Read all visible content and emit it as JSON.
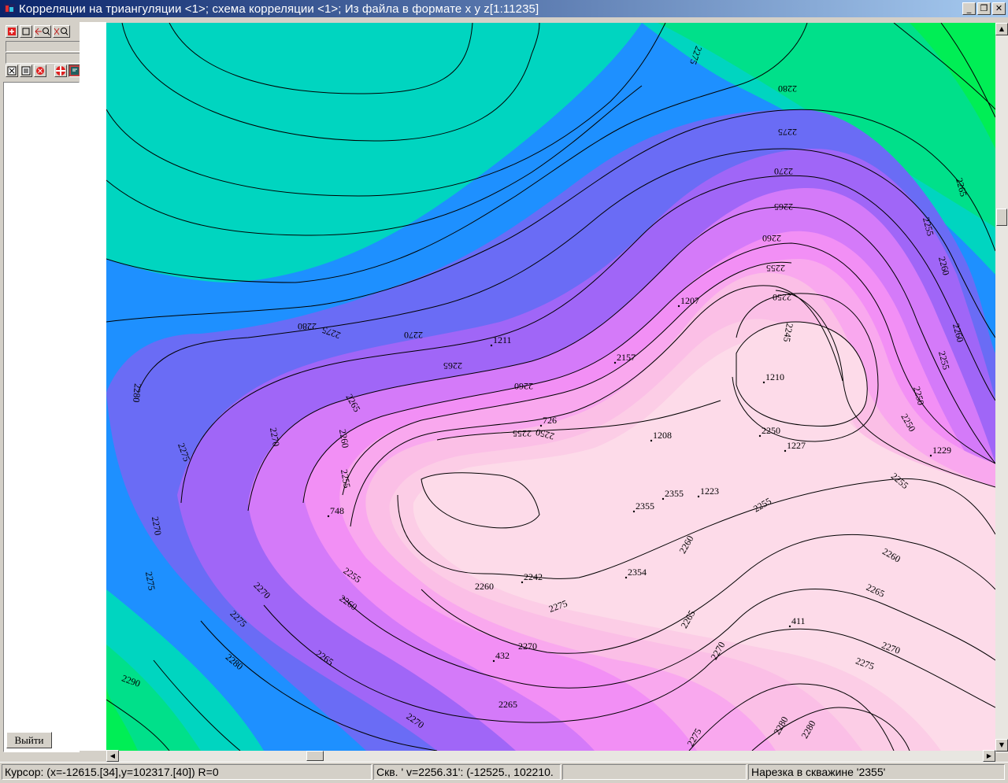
{
  "window": {
    "title": "Корреляции на триангуляции <1>; схема корреляции <1>; Из файла в формате x y z[1:11235]",
    "controls": [
      "_",
      "❐",
      "✕"
    ]
  },
  "left_panel": {
    "exit_label": "Выйти"
  },
  "status_bar": {
    "cursor": "Курсор: (x=-12615.[34],y=102317.[40]) R=0",
    "well": "Скв. ' v=2256.31': (-12525., 102210.",
    "empty": "",
    "cut": "Нарезка в скважине '2355'"
  },
  "map": {
    "palette": [
      "#00ee55",
      "#00e08a",
      "#00d5c0",
      "#00c0e8",
      "#1e90ff",
      "#6a6cf5",
      "#a066f7",
      "#d47af9",
      "#f28ff5",
      "#f9a8ee",
      "#fbbfe6",
      "#fccde6",
      "#fddbe9"
    ],
    "contour_labels": [
      "2275",
      "2280",
      "2275",
      "2270",
      "2265",
      "2260",
      "2255",
      "2250",
      "2245",
      "2280",
      "2275",
      "2270",
      "2265",
      "2260",
      "2255",
      "2250",
      "2255",
      "2260",
      "2265",
      "2270",
      "2275",
      "2280",
      "2255",
      "2260",
      "2265",
      "2270",
      "2275",
      "2280",
      "2290",
      "2270",
      "2265",
      "2270",
      "2275",
      "2250",
      "2255",
      "2260",
      "2265",
      "2270",
      "2275",
      "2280",
      "2260",
      "2265",
      "2270",
      "2275",
      "2280",
      "2255",
      "2260",
      "2270",
      "2275",
      "2260",
      "2255",
      "2250",
      "2255",
      "2260",
      "2265"
    ],
    "wells": [
      "1207",
      "1211",
      "2157",
      "1210",
      "726",
      "1208",
      "2250",
      "1227",
      "1229",
      "748",
      "2355",
      "2355",
      "1223",
      "2354",
      "2242",
      "411",
      "432"
    ]
  }
}
